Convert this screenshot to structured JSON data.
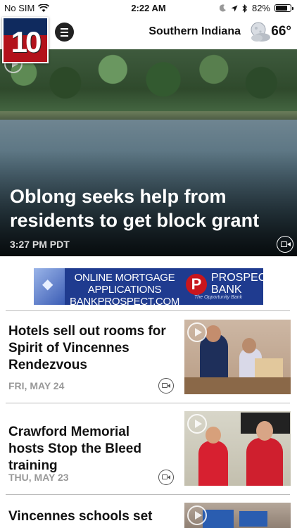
{
  "status_bar": {
    "carrier": "No SIM",
    "time": "2:22 AM",
    "battery_percent": "82%",
    "battery_level": 0.82,
    "icons": [
      "wifi-icon",
      "moon-icon",
      "location-arrow-icon",
      "bluetooth-icon",
      "battery-icon"
    ]
  },
  "header": {
    "logo_text": "10",
    "location": "Southern Indiana",
    "temperature": "66°",
    "weather_icon": "cloudy-night-icon",
    "menu_icon": "menu-icon"
  },
  "hero": {
    "headline": "Oblong seeks help from residents to get block grant",
    "time": "3:27 PM PDT"
  },
  "ad": {
    "line1": "ONLINE MORTGAGE APPLICATIONS",
    "line2": "BANKPROSPECT.COM",
    "brand_letter": "P",
    "brand_name_1": "PROSPECT",
    "brand_name_2": "BANK",
    "tagline": "The Opportunity Bank"
  },
  "stories": [
    {
      "title": "Hotels sell out rooms for Spirit of Vincennes Rendezvous",
      "date": "FRI, MAY 24"
    },
    {
      "title": "Crawford Memorial hosts Stop the Bleed training",
      "date": "THU, MAY 23"
    },
    {
      "title": "Vincennes schools set to"
    }
  ],
  "colors": {
    "brand_red": "#b3121b",
    "brand_blue": "#0f2a5e",
    "ad_blue": "#1f3b8f",
    "date_gray": "#999999"
  }
}
